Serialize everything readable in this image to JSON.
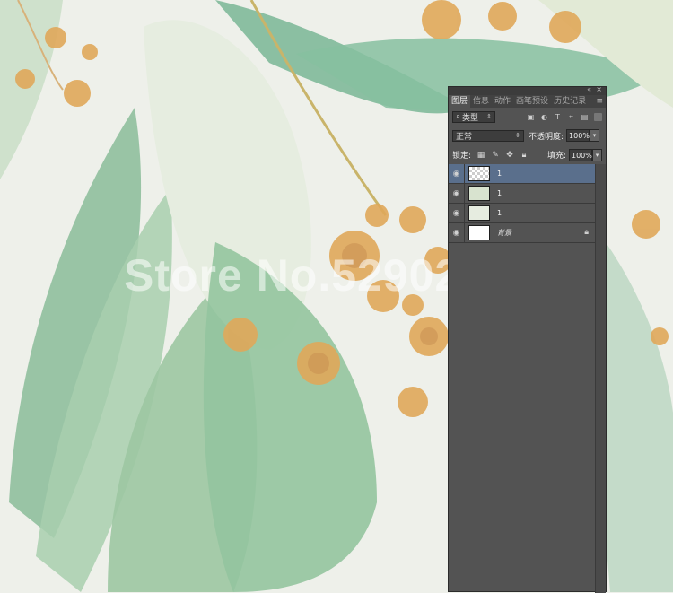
{
  "watermark": "Store No.5290232",
  "panel": {
    "tabs": [
      "图层",
      "信息",
      "动作",
      "画笔预设",
      "历史记录"
    ],
    "active_tab": "图层",
    "filter": {
      "label": "类型"
    },
    "blend": {
      "mode": "正常",
      "opacity_label": "不透明度:",
      "opacity_value": "100%"
    },
    "lock": {
      "label": "锁定:",
      "fill_label": "填充:",
      "fill_value": "100%"
    },
    "layers": [
      {
        "name": "1",
        "selected": true,
        "thumb": "transparent"
      },
      {
        "name": "1",
        "selected": false,
        "thumb": "green"
      },
      {
        "name": "1",
        "selected": false,
        "thumb": "pale"
      },
      {
        "name": "背景",
        "selected": false,
        "thumb": "white",
        "locked": true
      }
    ]
  },
  "icons": {
    "collapse": "double-chevron-icon",
    "close": "close-icon",
    "panel_menu": "menu-icon",
    "search": "search-icon",
    "eye": "eye-icon",
    "lock": "lock-icon"
  }
}
